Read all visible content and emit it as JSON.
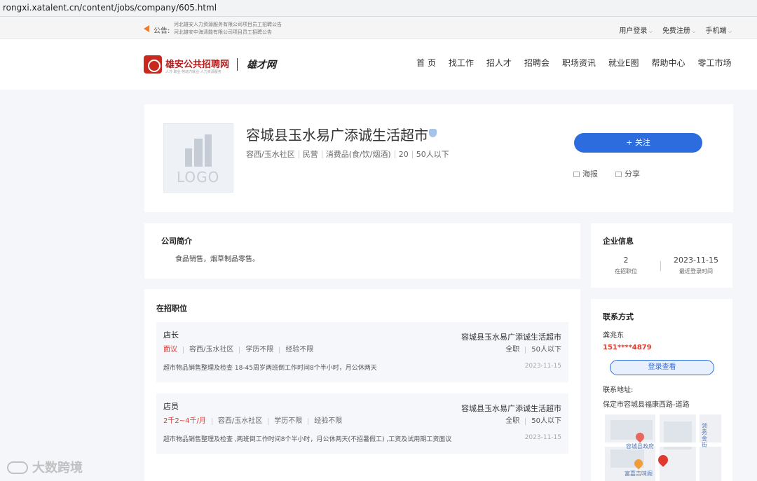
{
  "browser": {
    "url": "rongxi.xatalent.cn/content/jobs/company/605.html"
  },
  "topbar": {
    "notice_label": "公告:",
    "notice_lines": [
      "河北雄安人力资源服务有限公司项目员工招聘公告",
      "河北雄安中海清能有限公司项目员工招聘公告"
    ],
    "links": [
      "用户登录",
      "免费注册",
      "手机端"
    ]
  },
  "header": {
    "logo_title": "雄安公共招聘网",
    "logo_sub": "人才·职业·劳动力就业·人力资源服务",
    "brand": "雄才网",
    "nav": [
      "首 页",
      "找工作",
      "招人才",
      "招聘会",
      "职场资讯",
      "就业E图",
      "帮助中心",
      "零工市场"
    ]
  },
  "company": {
    "logo_text": "LOGO",
    "name": "容城县玉水易广添诚生活超市",
    "tags": [
      "容西/玉水社区",
      "民营",
      "消费品(食/饮/烟酒)",
      "20",
      "50人以下"
    ],
    "follow": "+ 关注",
    "poster": "海报",
    "share": "分享"
  },
  "intro": {
    "title": "公司简介",
    "text": "食品销售，烟草制品零售。"
  },
  "jobs": {
    "title": "在招职位",
    "items": [
      {
        "name": "店长",
        "salary": "面议",
        "area": "容西/玉水社区",
        "edu": "学历不限",
        "exp": "经验不限",
        "desc": "超市物品销售整理及检查 18-45周岁两班倒工作时间8个半小时，月公休两天",
        "company": "容城县玉水易广添诚生活超市",
        "type": "全职",
        "size": "50人以下",
        "date": "2023-11-15"
      },
      {
        "name": "店员",
        "salary": "2千2~4千/月",
        "area": "容西/玉水社区",
        "edu": "学历不限",
        "exp": "经验不限",
        "desc": "超市物品销售整理及检查 ,两班倒工作时间8个半小时，月公休两天(不招暑假工) ,工资及试用期工资面议",
        "company": "容城县玉水易广添诚生活超市",
        "type": "全职",
        "size": "50人以下",
        "date": "2023-11-15"
      }
    ]
  },
  "info": {
    "title": "企业信息",
    "jobs_count": "2",
    "jobs_label": "在招职位",
    "last_login": "2023-11-15",
    "last_login_label": "最近登录时间"
  },
  "contact": {
    "title": "联系方式",
    "name": "龚兆东",
    "phone": "151****4879",
    "login_btn": "登录查看",
    "addr_label": "联系地址:",
    "addr": "保定市容城县福康西路-道路",
    "map_labels": [
      "容城县政府",
      "富嘉吉味阁",
      "领秀金街"
    ]
  },
  "watermark": "大数跨境"
}
